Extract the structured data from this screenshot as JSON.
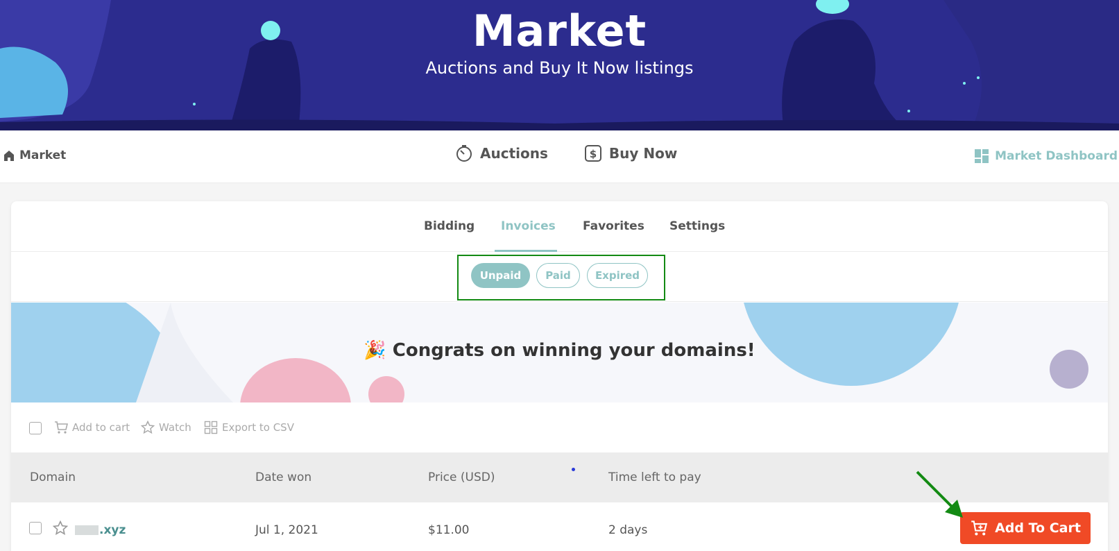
{
  "hero": {
    "title": "Market",
    "subtitle": "Auctions and Buy It Now listings"
  },
  "navbar": {
    "home_label": "Market",
    "links": [
      {
        "label": "Auctions",
        "icon": "stopwatch-icon"
      },
      {
        "label": "Buy Now",
        "icon": "dollar-tag-icon"
      }
    ],
    "dashboard_label": "Market Dashboard"
  },
  "tabs": [
    {
      "label": "Bidding"
    },
    {
      "label": "Invoices",
      "active": true
    },
    {
      "label": "Favorites"
    },
    {
      "label": "Settings"
    }
  ],
  "filters": [
    {
      "label": "Unpaid",
      "active": true
    },
    {
      "label": "Paid"
    },
    {
      "label": "Expired"
    }
  ],
  "banner": {
    "emoji": "🎉",
    "text": "Congrats on winning your domains!"
  },
  "toolbar": {
    "add_to_cart": "Add to cart",
    "watch": "Watch",
    "export": "Export to CSV"
  },
  "table": {
    "columns": [
      "Domain",
      "Date won",
      "Price (USD)",
      "Time left to pay"
    ],
    "rows": [
      {
        "domain": ".xyz",
        "date_won": "Jul 1, 2021",
        "price": "$11.00",
        "time_left": "2 days",
        "action": "Add To Cart"
      }
    ]
  },
  "colors": {
    "accent": "#8fc4c4",
    "cta": "#f04a26",
    "hero_bg": "#2a2a8a",
    "annotation": "#138a13"
  }
}
